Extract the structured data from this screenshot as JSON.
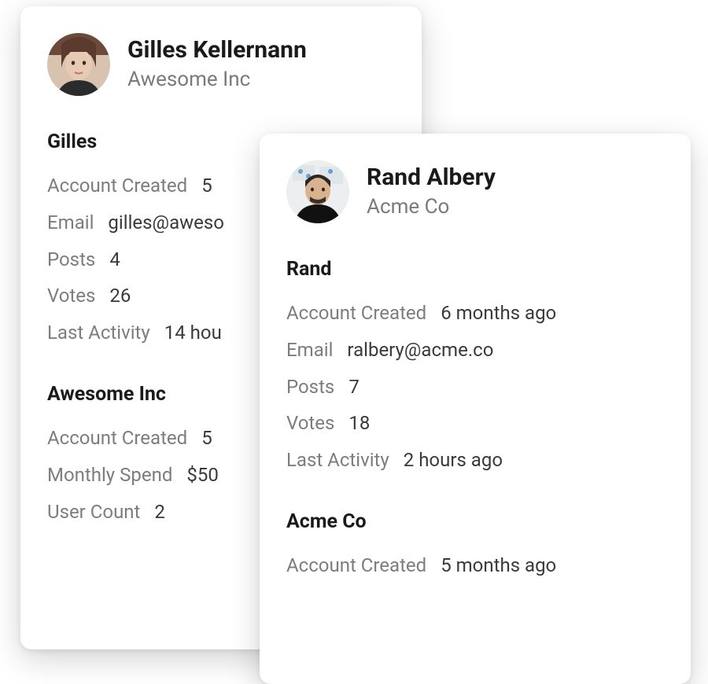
{
  "cards": [
    {
      "name": "Gilles Kellernann",
      "company": "Awesome Inc",
      "userSection": {
        "title": "Gilles",
        "fields": [
          {
            "label": "Account Created",
            "value": "5"
          },
          {
            "label": "Email",
            "value": "gilles@aweso"
          },
          {
            "label": "Posts",
            "value": "4"
          },
          {
            "label": "Votes",
            "value": "26"
          },
          {
            "label": "Last Activity",
            "value": "14 hou"
          }
        ]
      },
      "companySection": {
        "title": "Awesome Inc",
        "fields": [
          {
            "label": "Account Created",
            "value": "5"
          },
          {
            "label": "Monthly Spend",
            "value": "$50"
          },
          {
            "label": "User Count",
            "value": "2"
          }
        ]
      }
    },
    {
      "name": "Rand Albery",
      "company": "Acme Co",
      "userSection": {
        "title": "Rand",
        "fields": [
          {
            "label": "Account Created",
            "value": "6 months ago"
          },
          {
            "label": "Email",
            "value": "ralbery@acme.co"
          },
          {
            "label": "Posts",
            "value": "7"
          },
          {
            "label": "Votes",
            "value": "18"
          },
          {
            "label": "Last Activity",
            "value": "2 hours ago"
          }
        ]
      },
      "companySection": {
        "title": "Acme Co",
        "fields": [
          {
            "label": "Account Created",
            "value": "5 months ago"
          }
        ]
      }
    }
  ]
}
